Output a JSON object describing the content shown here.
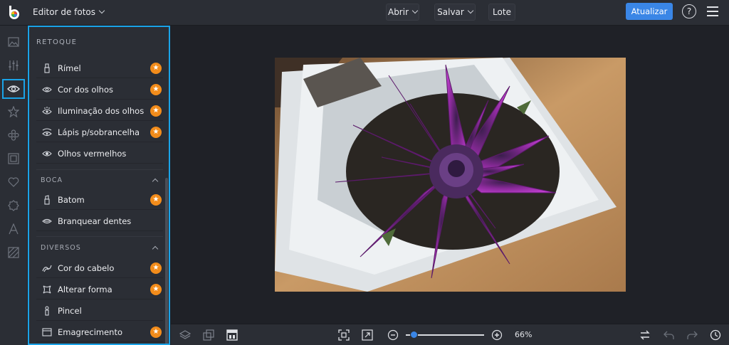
{
  "header": {
    "app_title": "Editor de fotos",
    "open_label": "Abrir",
    "save_label": "Salvar",
    "batch_label": "Lote",
    "update_label": "Atualizar",
    "help_label": "?"
  },
  "rail": {
    "icons": [
      "image-icon",
      "sliders-icon",
      "eye-icon",
      "star-icon",
      "effects-icon",
      "frame-icon",
      "heart-icon",
      "badge-icon",
      "text-icon",
      "texture-icon"
    ],
    "active": "eye-icon"
  },
  "panel": {
    "heading": "RETOQUE",
    "eyes_tools": [
      {
        "label": "Rímel",
        "premium": true
      },
      {
        "label": "Cor dos olhos",
        "premium": true
      },
      {
        "label": "Iluminação dos olhos",
        "premium": true
      },
      {
        "label": "Lápis p/sobrancelha",
        "premium": true
      },
      {
        "label": "Olhos vermelhos",
        "premium": false
      }
    ],
    "mouth_heading": "BOCA",
    "mouth_tools": [
      {
        "label": "Batom",
        "premium": true
      },
      {
        "label": "Branquear dentes",
        "premium": false
      }
    ],
    "misc_heading": "DIVERSOS",
    "misc_tools": [
      {
        "label": "Cor do cabelo",
        "premium": true
      },
      {
        "label": "Alterar forma",
        "premium": true
      },
      {
        "label": "Pincel",
        "premium": false
      },
      {
        "label": "Emagrecimento",
        "premium": true
      }
    ]
  },
  "footer": {
    "zoom_value": "66%",
    "zoom_level": 0.1
  },
  "colors": {
    "accent": "#3a86e6",
    "highlight": "#1aa3e8",
    "premium": "#f28c1b"
  }
}
